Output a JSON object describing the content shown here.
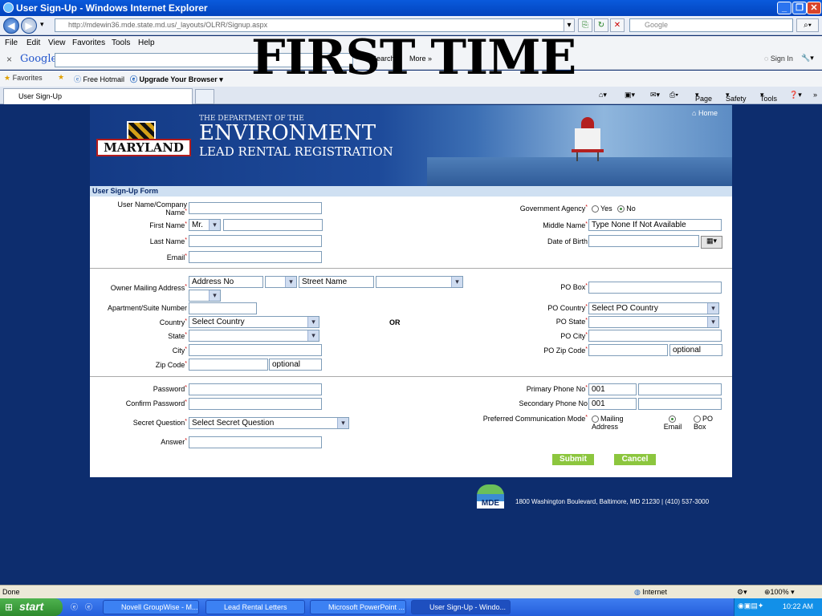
{
  "window": {
    "title": "User Sign-Up - Windows Internet Explorer"
  },
  "address_bar": {
    "url": "http://mdewin36.mde.state.md.us/_layouts/OLRR/Signup.aspx"
  },
  "search_box": {
    "placeholder": "Google"
  },
  "menu": [
    "File",
    "Edit",
    "View",
    "Favorites",
    "Tools",
    "Help"
  ],
  "google_toolbar": {
    "logo": "Google",
    "search": "Search",
    "more": "More »",
    "signin": "Sign In"
  },
  "favorites_bar": {
    "favorites": "Favorites",
    "items": [
      "Free Hotmail",
      "Upgrade Your Browser"
    ]
  },
  "tab": {
    "label": "User Sign-Up"
  },
  "command_bar": {
    "page": "Page",
    "safety": "Safety",
    "tools": "Tools"
  },
  "overlay_text": "FIRST TIME",
  "banner": {
    "logo": "MARYLAND",
    "dept": "THE DEPARTMENT OF THE",
    "env": "ENVIRONMENT",
    "sub": "LEAD RENTAL REGISTRATION",
    "home": "Home"
  },
  "form": {
    "header": "User Sign-Up Form",
    "username_label": "User Name/Company Name",
    "firstname_label": "First Name",
    "title_value": "Mr.",
    "lastname_label": "Last Name",
    "email_label": "Email",
    "gov_agency_label": "Government Agency",
    "gov_yes": "Yes",
    "gov_no": "No",
    "middlename_label": "Middle Name",
    "middlename_value": "Type None If Not Available",
    "dob_label": "Date of Birth",
    "owner_address_label": "Owner Mailing Address",
    "address_no_value": "Address No",
    "street_name_value": "Street Name",
    "apt_label": "Apartment/Suite Number",
    "country_label": "Country",
    "country_value": "Select Country",
    "state_label": "State",
    "city_label": "City",
    "zip_label": "Zip Code",
    "zip_optional": "optional",
    "or_label": "OR",
    "pobox_label": "PO Box",
    "pocountry_label": "PO Country",
    "pocountry_value": "Select PO Country",
    "postate_label": "PO State",
    "pocity_label": "PO City",
    "pozip_label": "PO Zip Code",
    "pozip_optional": "optional",
    "password_label": "Password",
    "confirm_password_label": "Confirm Password",
    "secret_question_label": "Secret Question",
    "secret_question_value": "Select Secret Question",
    "answer_label": "Answer",
    "primary_phone_label": "Primary Phone No",
    "primary_phone_code": "001",
    "secondary_phone_label": "Secondary Phone No",
    "secondary_phone_code": "001",
    "comm_mode_label": "Preferred Communication Mode",
    "comm_mailing": "Mailing Address",
    "comm_email": "Email",
    "comm_pobox": "PO Box",
    "submit": "Submit",
    "cancel": "Cancel"
  },
  "footer": {
    "logo": "MDE",
    "address": "1800 Washington Boulevard, Baltimore, MD 21230 | (410) 537-3000"
  },
  "status_bar": {
    "left": "Done",
    "zone": "Internet",
    "zoom": "100%"
  },
  "taskbar": {
    "start": "start",
    "tasks": [
      "Novell GroupWise - M...",
      "Lead Rental Letters",
      "Microsoft PowerPoint ...",
      "User Sign-Up - Windo..."
    ],
    "clock": "10:22 AM"
  }
}
